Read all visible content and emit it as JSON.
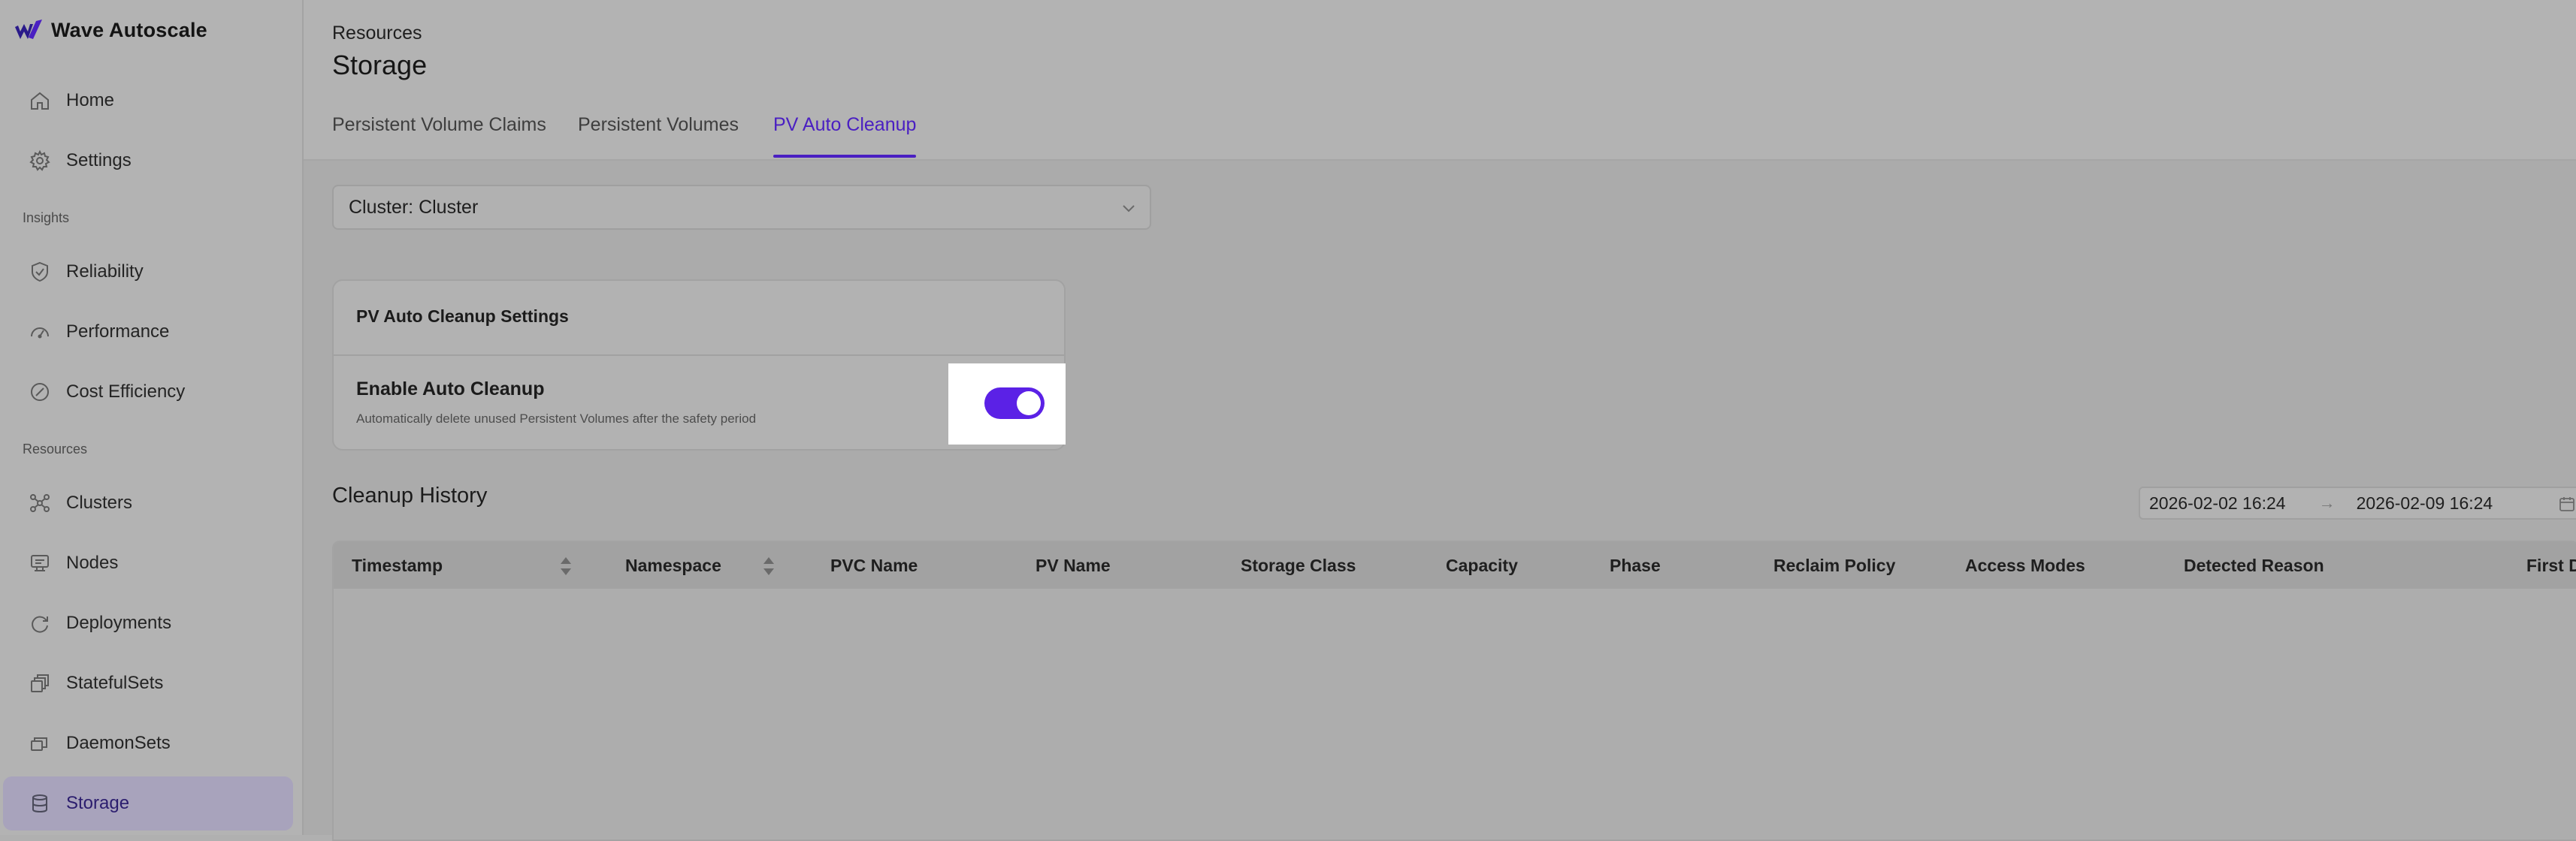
{
  "app": {
    "name": "Wave Autoscale"
  },
  "sidebar": {
    "items": [
      {
        "label": "Home",
        "icon": "home-icon"
      },
      {
        "label": "Settings",
        "icon": "gear-icon"
      }
    ],
    "sections": [
      {
        "label": "Insights",
        "items": [
          {
            "label": "Reliability",
            "icon": "shield-check-icon"
          },
          {
            "label": "Performance",
            "icon": "gauge-icon"
          },
          {
            "label": "Cost Efficiency",
            "icon": "percent-badge-icon"
          }
        ]
      },
      {
        "label": "Resources",
        "items": [
          {
            "label": "Clusters",
            "icon": "cluster-network-icon"
          },
          {
            "label": "Nodes",
            "icon": "server-icon"
          },
          {
            "label": "Deployments",
            "icon": "refresh-icon"
          },
          {
            "label": "StatefulSets",
            "icon": "stack-icon"
          },
          {
            "label": "DaemonSets",
            "icon": "stack-icon"
          },
          {
            "label": "Storage",
            "icon": "database-icon",
            "active": true
          }
        ]
      }
    ]
  },
  "header": {
    "breadcrumb": "Resources",
    "title": "Storage",
    "tabs": [
      {
        "label": "Persistent Volume Claims"
      },
      {
        "label": "Persistent Volumes"
      },
      {
        "label": "PV Auto Cleanup",
        "active": true
      }
    ]
  },
  "filters": {
    "cluster_select": "Cluster: Cluster"
  },
  "settings": {
    "title": "PV Auto Cleanup Settings",
    "enable_label": "Enable Auto Cleanup",
    "enable_description": "Automatically delete unused Persistent Volumes after the safety period",
    "enabled": true
  },
  "history": {
    "title": "Cleanup History",
    "date_from": "2026-02-02 16:24",
    "date_to": "2026-02-09 16:24",
    "date_separator": "→",
    "columns": [
      "Timestamp",
      "Namespace",
      "PVC Name",
      "PV Name",
      "Storage Class",
      "Capacity",
      "Phase",
      "Reclaim Policy",
      "Access Modes",
      "Detected Reason",
      "First De"
    ],
    "rows": []
  },
  "colors": {
    "accent": "#5b21e6",
    "tab_active": "#4a1fc2"
  }
}
